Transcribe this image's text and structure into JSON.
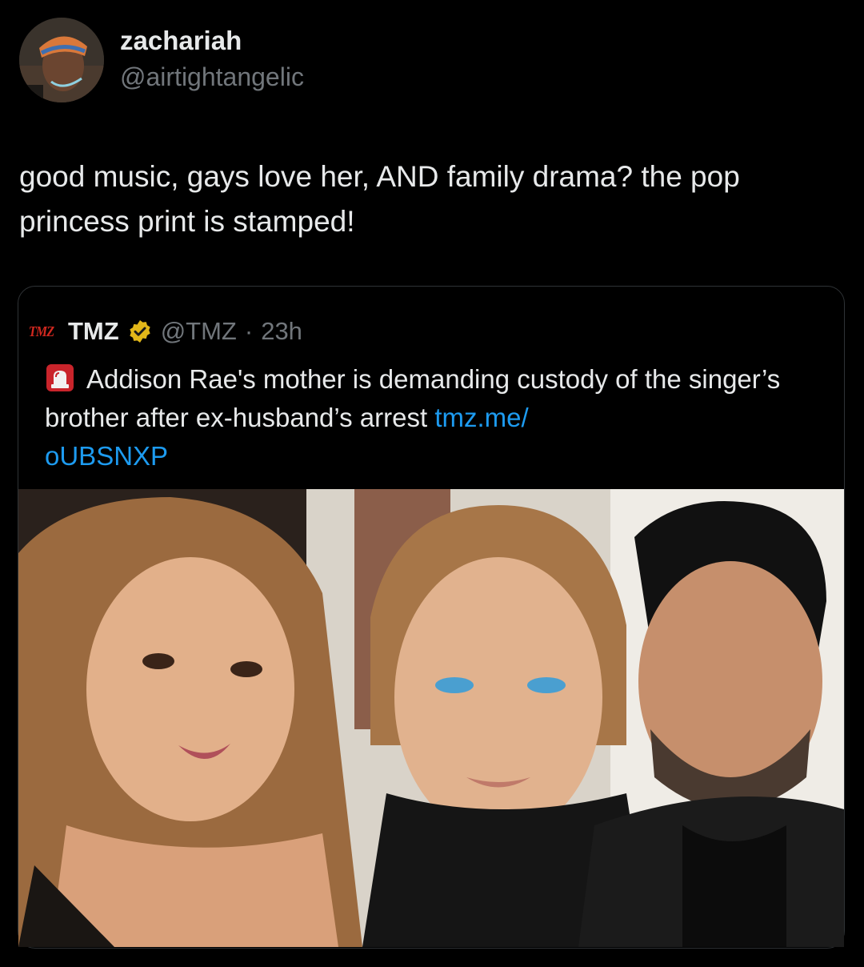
{
  "author": {
    "display_name": "zachariah",
    "handle": "@airtightangelic"
  },
  "tweet": {
    "text_line1": "good music, gays love her, AND family drama? the pop",
    "text_line2": "princess print is stamped!"
  },
  "quoted": {
    "logo": "TMZ",
    "name": "TMZ",
    "handle": "@TMZ",
    "separator": "·",
    "time": "23h",
    "icon": "rotating-light-icon",
    "text": "Addison Rae's mother is demanding custody of the singer’s brother after ex-husband’s arrest ",
    "link": "tmz.me/\noUBSNXP"
  },
  "colors": {
    "background": "#000000",
    "text": "#e7e9ea",
    "secondary": "#71767b",
    "link": "#1d9bf0",
    "verified": "#e2b719",
    "tmz_red": "#d1281f"
  }
}
